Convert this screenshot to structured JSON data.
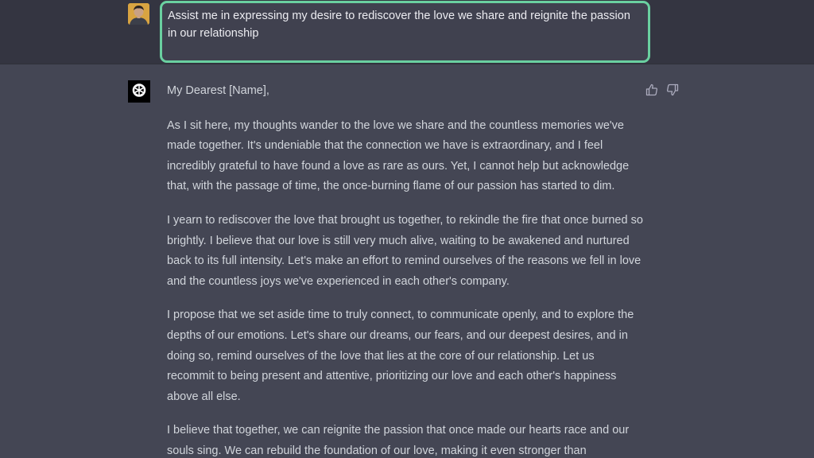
{
  "user": {
    "avatar_icon": "user-avatar-icon",
    "prompt": "Assist me in expressing my desire to rediscover the love we share and reignite the passion in our relationship",
    "prompt_border_color": "#6ad0a0"
  },
  "assistant": {
    "avatar_icon": "openai-logo-icon",
    "feedback": {
      "thumbs_up_icon": "thumbs-up-icon",
      "thumbs_down_icon": "thumbs-down-icon"
    },
    "greeting": "My Dearest [Name],",
    "paragraphs": [
      "As I sit here, my thoughts wander to the love we share and the countless memories we've made together. It's undeniable that the connection we have is extraordinary, and I feel incredibly grateful to have found a love as rare as ours. Yet, I cannot help but acknowledge that, with the passage of time, the once-burning flame of our passion has started to dim.",
      "I yearn to rediscover the love that brought us together, to rekindle the fire that once burned so brightly. I believe that our love is still very much alive, waiting to be awakened and nurtured back to its full intensity. Let's make an effort to remind ourselves of the reasons we fell in love and the countless joys we've experienced in each other's company.",
      "I propose that we set aside time to truly connect, to communicate openly, and to explore the depths of our emotions. Let's share our dreams, our fears, and our deepest desires, and in doing so, remind ourselves of the love that lies at the core of our relationship. Let us recommit to being present and attentive, prioritizing our love and each other's happiness above all else.",
      "I believe that together, we can reignite the passion that once made our hearts race and our souls sing. We can rebuild the foundation of our love, making it even stronger than"
    ]
  },
  "colors": {
    "user_bg": "#343541",
    "assistant_bg": "#444654",
    "text": "#d1d5db"
  }
}
